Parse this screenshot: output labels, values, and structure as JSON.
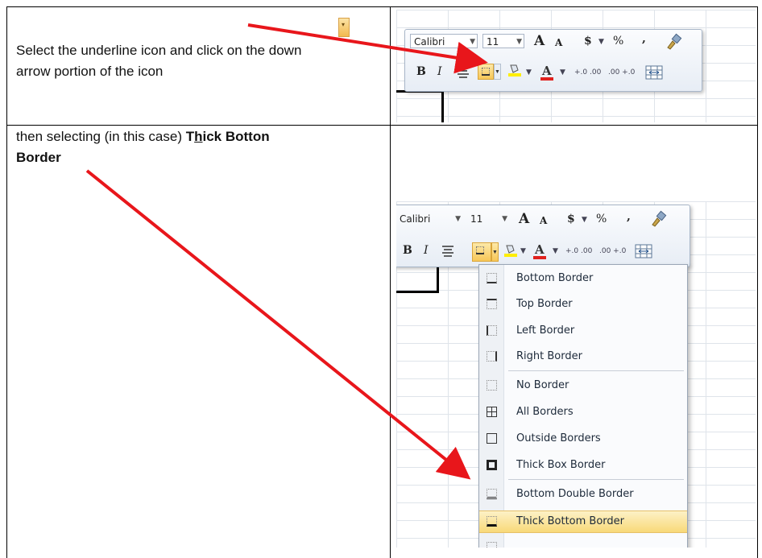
{
  "step1": {
    "text": "Select the underline icon and click on the down arrow portion of the icon"
  },
  "step2": {
    "prefix": "then selecting (in this case) ",
    "bold_pre": "T",
    "bold_underlined": "h",
    "bold_post": "ick Botton",
    "line2": "Border"
  },
  "toolbar1": {
    "font_name": "Calibri",
    "font_size": "11",
    "grow": "A",
    "shrink": "A",
    "currency": "$",
    "percent": "%",
    "comma": ",",
    "bold": "B",
    "italic": "I",
    "font_color": "A",
    "inc_decimal": "+.0 .00",
    "dec_decimal": ".00 +.0"
  },
  "toolbar2": {
    "font_name": "Calibri",
    "font_size": "11",
    "grow": "A",
    "shrink": "A",
    "currency": "$",
    "percent": "%",
    "comma": ",",
    "bold": "B",
    "italic": "I",
    "font_color": "A",
    "inc_decimal": "+.0 .00",
    "dec_decimal": ".00 +.0"
  },
  "border_menu": {
    "items": [
      {
        "label": "Bottom Border",
        "icon": "bottom-border-icon"
      },
      {
        "label": "Top Border",
        "icon": "top-border-icon"
      },
      {
        "label": "Left Border",
        "icon": "left-border-icon"
      },
      {
        "label": "Right Border",
        "icon": "right-border-icon"
      },
      {
        "label": "No Border",
        "icon": "no-border-icon"
      },
      {
        "label": "All Borders",
        "icon": "all-borders-icon"
      },
      {
        "label": "Outside Borders",
        "icon": "outside-borders-icon"
      },
      {
        "label": "Thick Box Border",
        "icon": "thick-box-border-icon"
      },
      {
        "label": "Bottom Double Border",
        "icon": "bottom-double-border-icon"
      },
      {
        "label": "Thick Bottom Border",
        "icon": "thick-bottom-border-icon"
      }
    ],
    "highlighted": "Thick Bottom Border"
  },
  "colors": {
    "arrow": "#e8161b",
    "highlight": "#f8d978",
    "font_color_bar": "#e0211d",
    "fill_color_bar": "#ffee00"
  }
}
